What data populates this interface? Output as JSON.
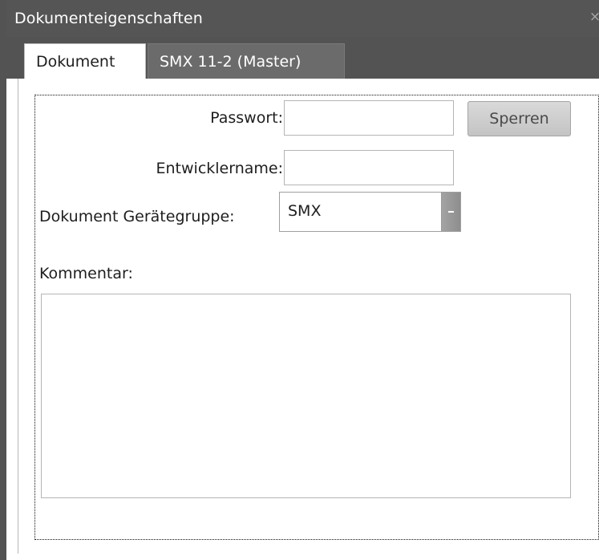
{
  "window": {
    "title": "Dokumenteigenschaften",
    "close_glyph": "×"
  },
  "tabs": [
    {
      "label": "Dokument",
      "active": true
    },
    {
      "label": "SMX 11-2 (Master)",
      "active": false
    }
  ],
  "form": {
    "password_label": "Passwort:",
    "password_value": "",
    "lock_button_label": "Sperren",
    "developer_label": "Entwicklername:",
    "developer_value": "",
    "device_group_label": "Dokument Gerätegruppe:",
    "device_group_value": "SMX",
    "comment_label": "Kommentar:",
    "comment_value": ""
  },
  "colors": {
    "titlebar": "#555555",
    "tab_active_bg": "#ffffff",
    "tab_inactive_bg": "#6b6b6b",
    "button_bg": "#cfcfcf"
  },
  "icons": {
    "close": "close-icon",
    "dropdown": "chevron-down-icon"
  }
}
